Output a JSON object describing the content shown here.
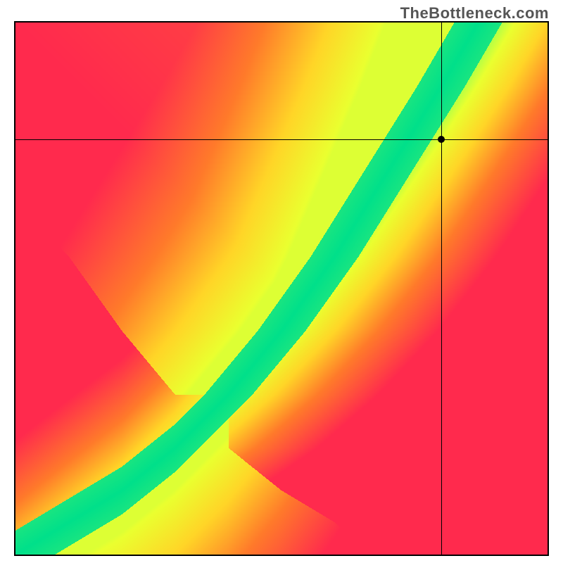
{
  "watermark": "TheBottleneck.com",
  "chart_data": {
    "type": "heatmap",
    "title": "",
    "xlabel": "",
    "ylabel": "",
    "xlim": [
      0,
      1
    ],
    "ylim": [
      0,
      1
    ],
    "color_scale": {
      "stops": [
        {
          "v": 0.0,
          "color": "#ff2a4d"
        },
        {
          "v": 0.35,
          "color": "#ff7a2a"
        },
        {
          "v": 0.6,
          "color": "#ffd527"
        },
        {
          "v": 0.8,
          "color": "#eaff2f"
        },
        {
          "v": 0.9,
          "color": "#a8ff4a"
        },
        {
          "v": 1.0,
          "color": "#00e08a"
        }
      ]
    },
    "ridge": {
      "description": "optimal-pairing curve; green band along it, fading toward red away from it",
      "control_points_xy": [
        [
          0.0,
          0.0
        ],
        [
          0.1,
          0.06
        ],
        [
          0.2,
          0.12
        ],
        [
          0.3,
          0.2
        ],
        [
          0.4,
          0.3
        ],
        [
          0.5,
          0.42
        ],
        [
          0.6,
          0.56
        ],
        [
          0.7,
          0.72
        ],
        [
          0.8,
          0.88
        ],
        [
          0.87,
          1.0
        ]
      ],
      "band_half_width": 0.045
    },
    "background_corners": {
      "top_left": "red",
      "bottom_left": "red",
      "bottom_right": "red",
      "top_right": "yellow-orange"
    },
    "crosshair": {
      "x": 0.8,
      "y": 0.78
    },
    "marker": {
      "x": 0.8,
      "y": 0.78,
      "color": "#000000"
    }
  },
  "plot": {
    "border_color": "#000000",
    "crosshair_color": "#000000",
    "marker_color": "#000000"
  }
}
